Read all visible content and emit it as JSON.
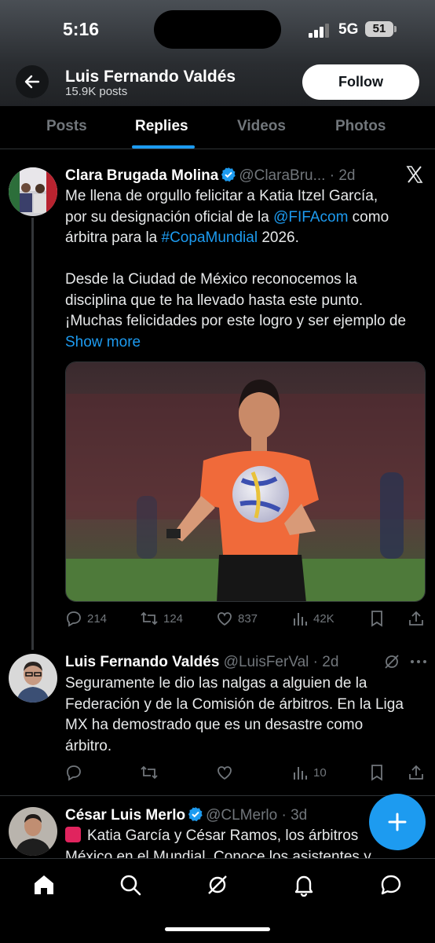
{
  "status_bar": {
    "time": "5:16",
    "network": "5G",
    "battery": "51"
  },
  "header": {
    "profile_name": "Luis Fernando Valdés",
    "post_count": "15.9K posts",
    "follow_label": "Follow"
  },
  "tabs": [
    {
      "label": "Posts"
    },
    {
      "label": "Replies"
    },
    {
      "label": "Videos"
    },
    {
      "label": "Photos"
    }
  ],
  "tweets": [
    {
      "author": "Clara Brugada Molina",
      "handle": "@ClaraBru...",
      "age": "· 2d",
      "text_line1": "Me llena de orgullo felicitar a Katia Itzel García,",
      "text_line2_pre": "por su designación oficial de la ",
      "mention": "@FIFAcom",
      "text_line2_post": " como",
      "text_line3_pre": "árbitra para la ",
      "hashtag": "#CopaMundial",
      "text_line3_post": " 2026.",
      "text_para2": "Desde la Ciudad de México reconocemos la disciplina que te ha llevado hasta este punto. ¡Muchas felicidades por este logro y ser ejemplo de",
      "show_more": "Show more",
      "stats": {
        "replies": "214",
        "reposts": "124",
        "likes": "837",
        "views": "42K"
      }
    },
    {
      "author": "Luis Fernando Valdés",
      "handle": "@LuisFerVal",
      "age": "· 2d",
      "text": "Seguramente le dio las nalgas a alguien de la Federación y de la Comisión de árbitros. En la Liga MX ha demostrado que es un desastre como árbitro.",
      "stats": {
        "views": "10"
      }
    },
    {
      "author": "César Luis Merlo",
      "handle": "@CLMerlo",
      "age": "· 3d",
      "text_line1": "Katia García y César Ramos, los árbitros",
      "text_line2": "México en el Mundial. Conoce los asistentes y"
    }
  ],
  "colors": {
    "accent": "#1d9bf0",
    "background": "#000000",
    "muted": "#71767b"
  }
}
